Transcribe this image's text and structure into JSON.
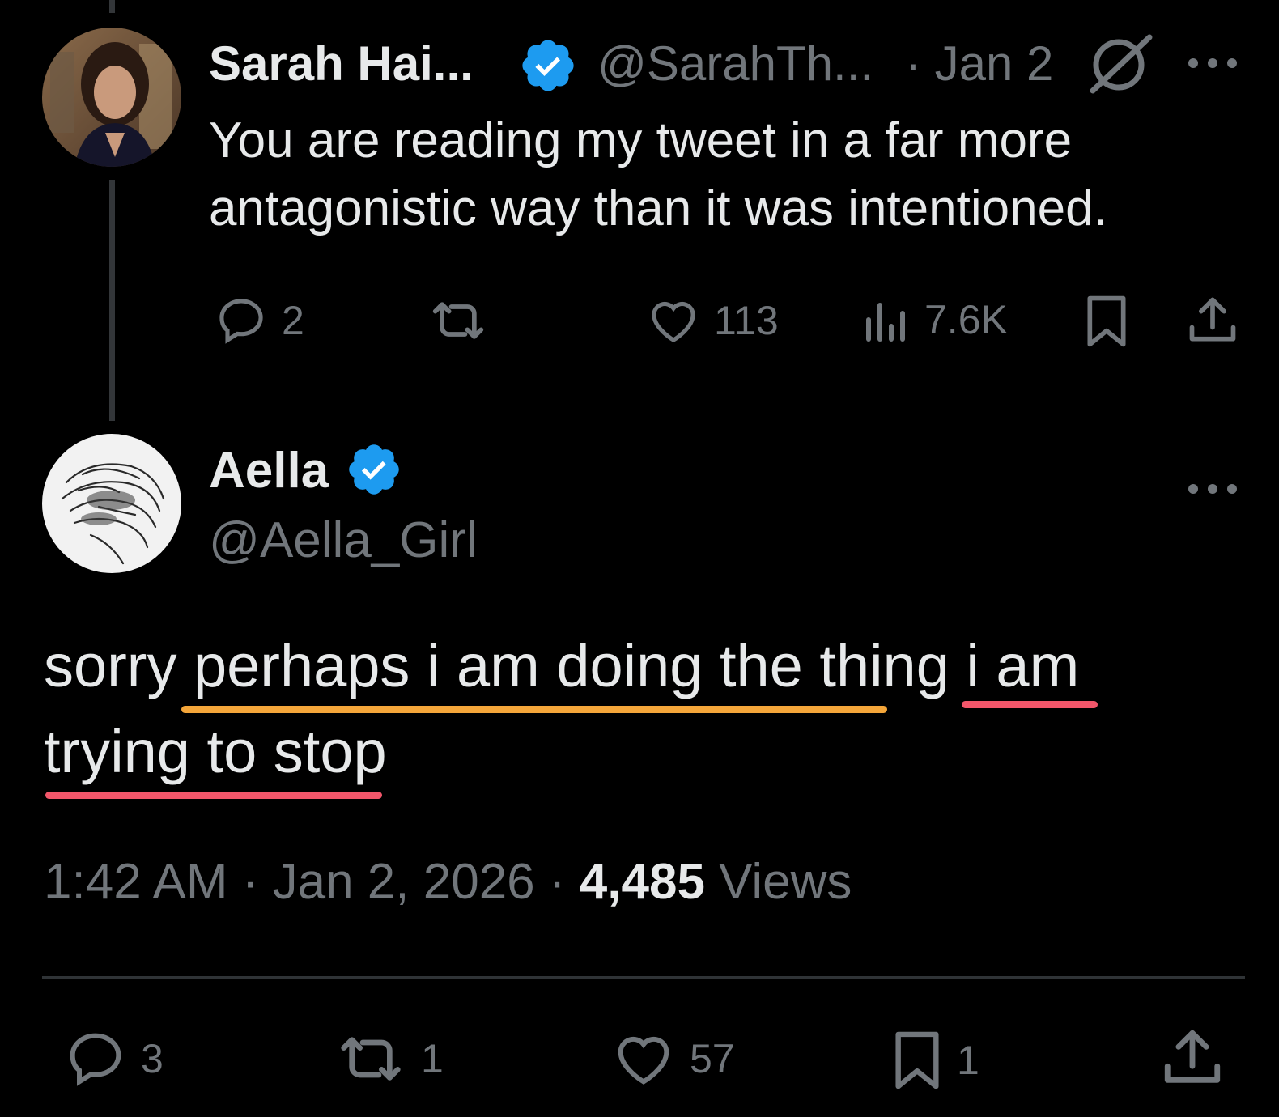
{
  "parent_tweet": {
    "display_name": "Sarah Hai...",
    "handle": "@SarahTh...",
    "date": "· Jan 2",
    "text_line1": "You are reading my tweet in a far more",
    "text_line2": "antagonistic way than it was intentioned.",
    "replies": "2",
    "likes": "113",
    "views": "7.6K"
  },
  "main_tweet": {
    "display_name": "Aella",
    "handle": "@Aella_Girl",
    "text_line1": "sorry perhaps i am doing the thing i am",
    "text_line2": "trying to stop",
    "time": "1:42 AM",
    "sep1": "·",
    "date": "Jan 2, 2026",
    "sep2": "·",
    "views_count": "4,485",
    "views_label": "Views",
    "replies": "3",
    "reposts": "1",
    "likes": "57",
    "bookmarks": "1"
  },
  "colors": {
    "verified": "#1d9bf0",
    "orange_underline": "#f4a63a",
    "pink_underline": "#f2566a"
  }
}
